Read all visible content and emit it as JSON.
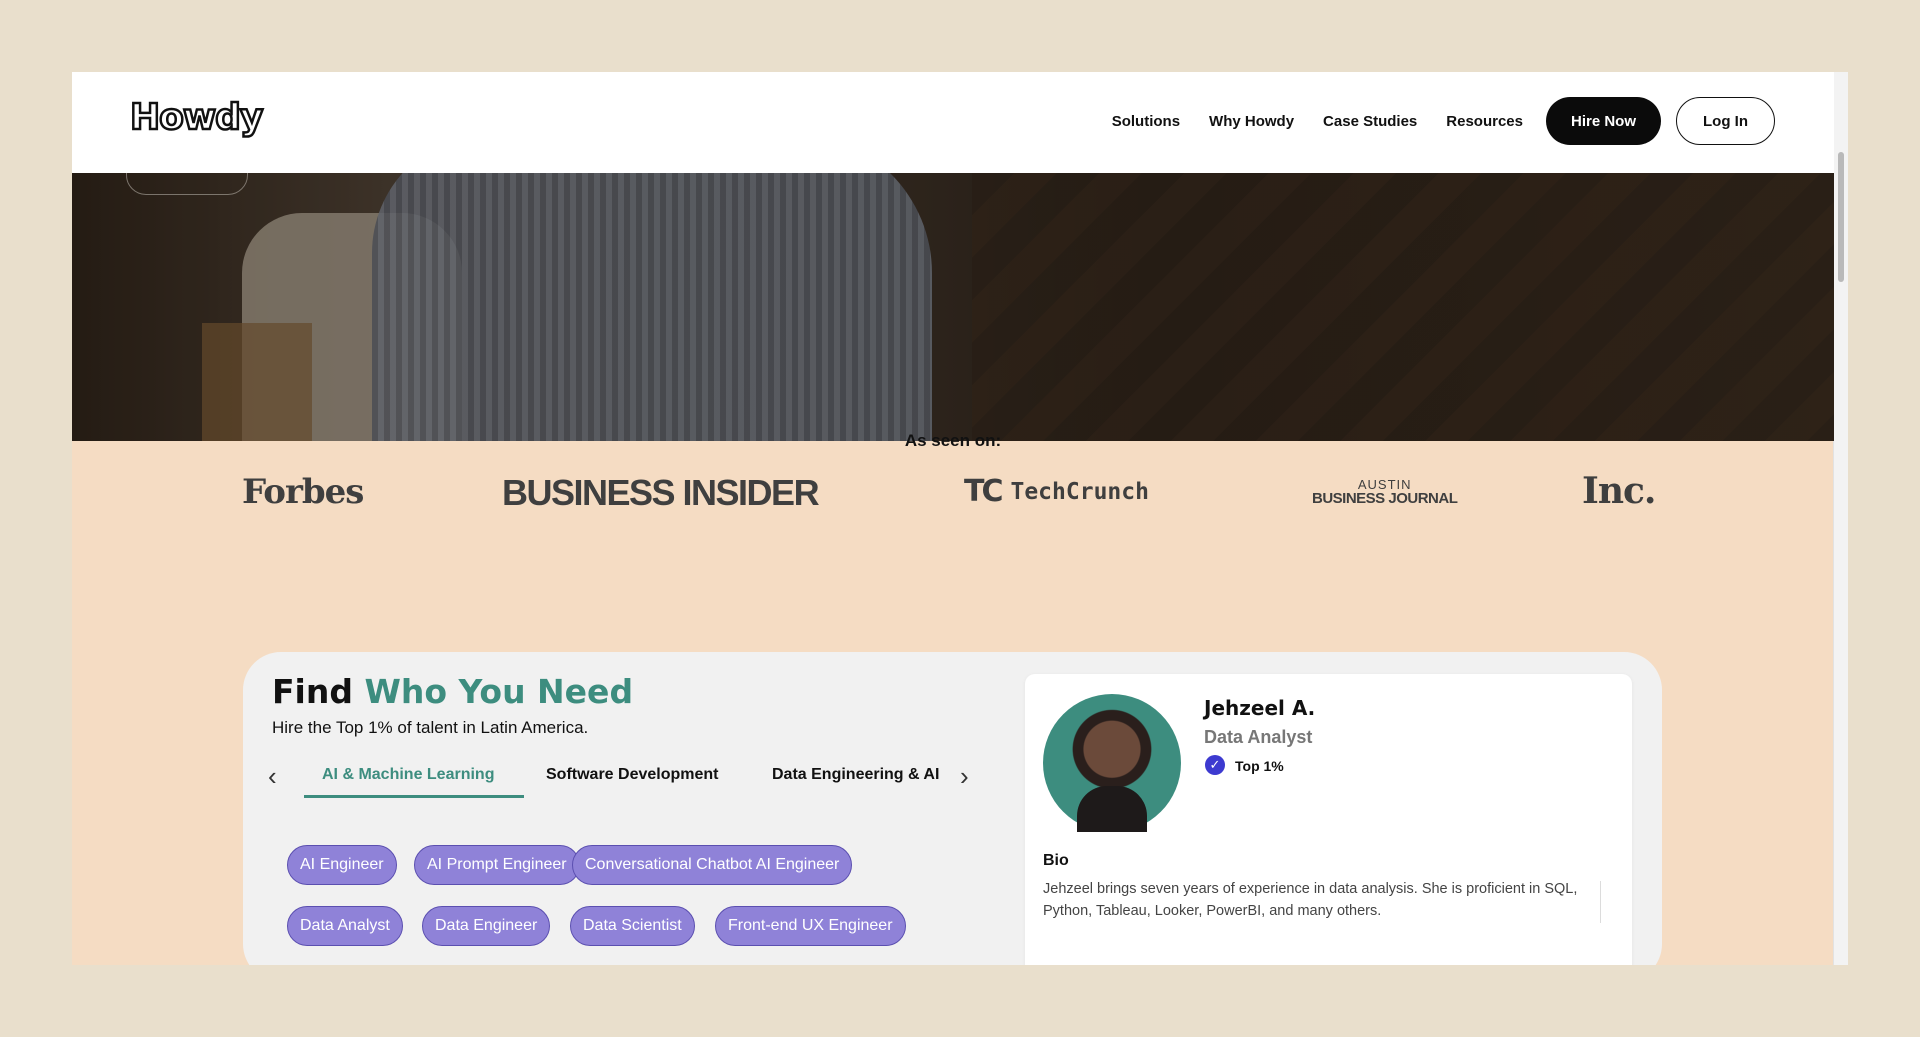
{
  "header": {
    "logo": "Howdy",
    "nav": [
      "Solutions",
      "Why Howdy",
      "Case Studies",
      "Resources"
    ],
    "hire_label": "Hire Now",
    "login_label": "Log In"
  },
  "press": {
    "title": "As seen on:",
    "logos": {
      "forbes": "Forbes",
      "business_insider": "BUSINESS INSIDER",
      "techcrunch_mark": "TC",
      "techcrunch": "TechCrunch",
      "austin_top": "AUSTIN",
      "austin_bottom": "BUSINESS JOURNAL",
      "inc": "Inc."
    }
  },
  "finder": {
    "title_plain": "Find",
    "title_accent": "Who You Need",
    "subtitle": "Hire the Top 1% of talent in Latin America.",
    "tabs": [
      "AI & Machine Learning",
      "Software Development",
      "Data Engineering & AI"
    ],
    "active_tab": "AI & Machine Learning",
    "roles": [
      "AI Engineer",
      "AI Prompt Engineer",
      "Conversational Chatbot AI Engineer",
      "Data Analyst",
      "Data Engineer",
      "Data Scientist",
      "Front-end UX Engineer"
    ],
    "accent_color": "#3d8d7f",
    "chip_color": "#8f82d8"
  },
  "candidate": {
    "name": "Jehzeel A.",
    "role": "Data Analyst",
    "badge": "Top 1%",
    "bio_title": "Bio",
    "bio": "Jehzeel brings seven years of experience in data analysis. She is proficient in SQL, Python, Tableau, Looker, PowerBI, and many others."
  }
}
